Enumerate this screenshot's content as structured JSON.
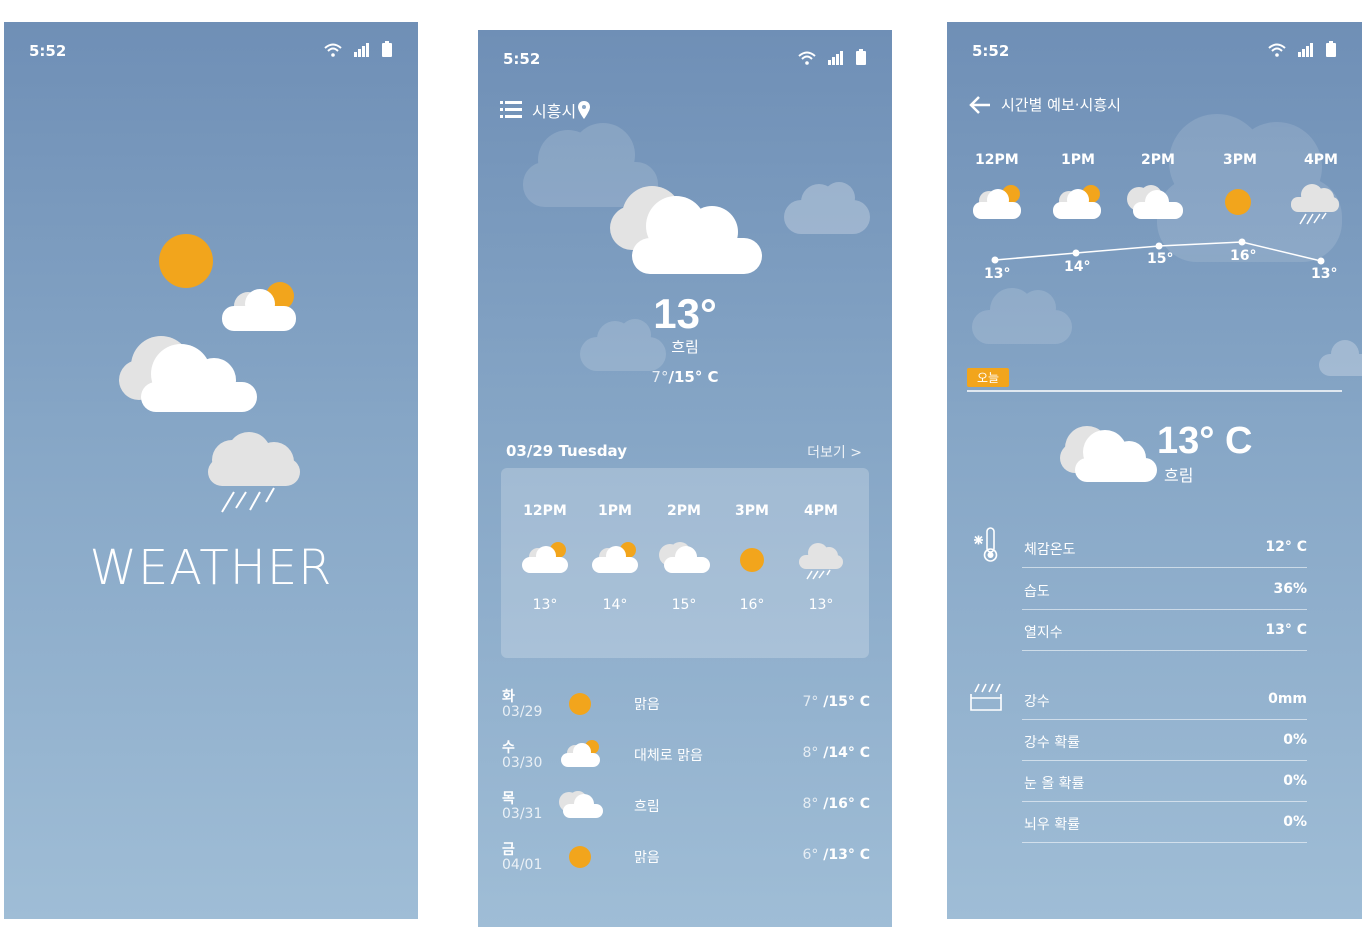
{
  "colors": {
    "sun": "#f2a51c",
    "cloud": "#ffffff",
    "cloud_shade": "#dcdcdc",
    "bg_top": "#6f8fb6",
    "bg_bottom": "#9fbdd6"
  },
  "splash": {
    "status_time": "5:52",
    "title": "WEATHER",
    "icons": [
      "wifi-icon",
      "signal-icon",
      "battery-icon",
      "sun-icon",
      "partly-cloudy-icon",
      "cloudy-icon",
      "rain-icon"
    ]
  },
  "main": {
    "status_time": "5:52",
    "location": "시흥시",
    "current_temp": "13°",
    "condition": "흐림",
    "range_low": "7°",
    "range_high": "/15° C",
    "date_label": "03/29 Tuesday",
    "more_label": "더보기 >",
    "hourly": [
      {
        "time": "12PM",
        "temp": "13°",
        "icon": "partly-cloudy-icon"
      },
      {
        "time": "1PM",
        "temp": "14°",
        "icon": "partly-cloudy-icon"
      },
      {
        "time": "2PM",
        "temp": "15°",
        "icon": "cloudy-icon"
      },
      {
        "time": "3PM",
        "temp": "16°",
        "icon": "sun-icon"
      },
      {
        "time": "4PM",
        "temp": "13°",
        "icon": "rain-icon"
      }
    ],
    "daily": [
      {
        "day": "화",
        "date": "03/29",
        "desc": "맑음",
        "low": "7°",
        "high": " /15° C",
        "icon": "sun-icon"
      },
      {
        "day": "수",
        "date": "03/30",
        "desc": "대체로 맑음",
        "low": "8°",
        "high": " /14° C",
        "icon": "partly-cloudy-icon"
      },
      {
        "day": "목",
        "date": "03/31",
        "desc": "흐림",
        "low": "8°",
        "high": " /16° C",
        "icon": "cloudy-icon"
      },
      {
        "day": "금",
        "date": "04/01",
        "desc": "맑음",
        "low": "6°",
        "high": " /13° C",
        "icon": "sun-icon"
      }
    ]
  },
  "detail": {
    "status_time": "5:52",
    "title": "시간별 예보·시흥시",
    "hourly": [
      {
        "time": "12PM",
        "temp": "13°",
        "icon": "partly-cloudy-icon"
      },
      {
        "time": "1PM",
        "temp": "14°",
        "icon": "partly-cloudy-icon"
      },
      {
        "time": "2PM",
        "temp": "15°",
        "icon": "cloudy-icon"
      },
      {
        "time": "3PM",
        "temp": "16°",
        "icon": "sun-icon"
      },
      {
        "time": "4PM",
        "temp": "13°",
        "icon": "rain-icon"
      }
    ],
    "today_label": "오늘",
    "current_temp": "13° C",
    "condition": "흐림",
    "temp_group": [
      {
        "label": "체감온도",
        "value": "12° C"
      },
      {
        "label": "습도",
        "value": "36%"
      },
      {
        "label": "열지수",
        "value": "13° C"
      }
    ],
    "precip_group": [
      {
        "label": "강수",
        "value": "0mm"
      },
      {
        "label": "강수 확률",
        "value": "0%"
      },
      {
        "label": "눈 올 확률",
        "value": "0%"
      },
      {
        "label": "뇌우 확률",
        "value": "0%"
      }
    ]
  }
}
